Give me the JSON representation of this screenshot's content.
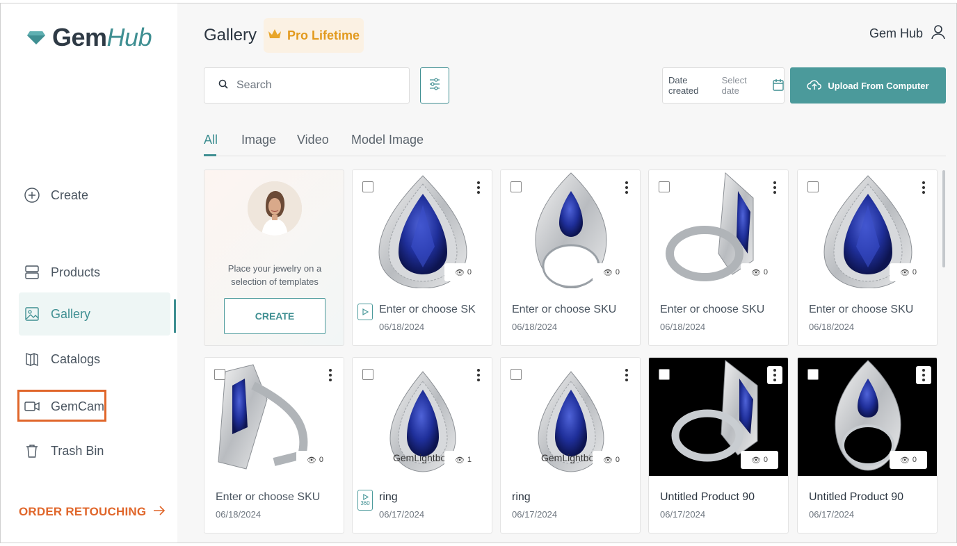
{
  "brand": {
    "name_part1": "Gem",
    "name_part2": "Hub"
  },
  "sidebar": {
    "items": [
      {
        "label": "Create",
        "icon": "plus-circle-icon"
      },
      {
        "label": "Products",
        "icon": "products-icon"
      },
      {
        "label": "Gallery",
        "icon": "image-icon",
        "active": true
      },
      {
        "label": "Catalogs",
        "icon": "book-icon"
      },
      {
        "label": "GemCam",
        "icon": "video-camera-icon"
      },
      {
        "label": "Trash Bin",
        "icon": "trash-icon"
      }
    ],
    "order_retouching": "ORDER RETOUCHING"
  },
  "header": {
    "title": "Gallery",
    "pro_badge": "Pro Lifetime",
    "user_name": "Gem Hub"
  },
  "toolbar": {
    "search_placeholder": "Search",
    "date_label": "Date created",
    "date_placeholder": "Select date",
    "upload_label": "Upload From Computer"
  },
  "tabs": [
    "All",
    "Image",
    "Video",
    "Model Image"
  ],
  "create_card": {
    "text_line1": "Place your jewelry on a",
    "text_line2": "selection of templates",
    "button": "CREATE"
  },
  "cards": [
    {
      "title": "Enter or choose SK",
      "date": "06/18/2024",
      "views": "0",
      "media": "video",
      "watermark": ""
    },
    {
      "title": "Enter or choose SKU",
      "date": "06/18/2024",
      "views": "0",
      "media": "image",
      "watermark": ""
    },
    {
      "title": "Enter or choose SKU",
      "date": "06/18/2024",
      "views": "0",
      "media": "image",
      "watermark": ""
    },
    {
      "title": "Enter or choose SKU",
      "date": "06/18/2024",
      "views": "0",
      "media": "image",
      "watermark": ""
    },
    {
      "title": "Enter or choose SKU",
      "date": "06/18/2024",
      "views": "0",
      "media": "image",
      "watermark": ""
    },
    {
      "title": "ring",
      "date": "06/17/2024",
      "views": "1",
      "media": "360",
      "watermark": "GemLightbox",
      "badge360": "360"
    },
    {
      "title": "ring",
      "date": "06/17/2024",
      "views": "0",
      "media": "image",
      "watermark": "GemLightbox"
    },
    {
      "title": "Untitled Product 90",
      "date": "06/17/2024",
      "views": "0",
      "media": "image",
      "watermark": ""
    },
    {
      "title": "Untitled Product 90",
      "date": "06/17/2024",
      "views": "0",
      "media": "image",
      "watermark": ""
    }
  ],
  "colors": {
    "accent": "#4b9a9b",
    "orange": "#e0662a",
    "gold": "#e29a1e",
    "sapphire": "#1f2f9a"
  }
}
